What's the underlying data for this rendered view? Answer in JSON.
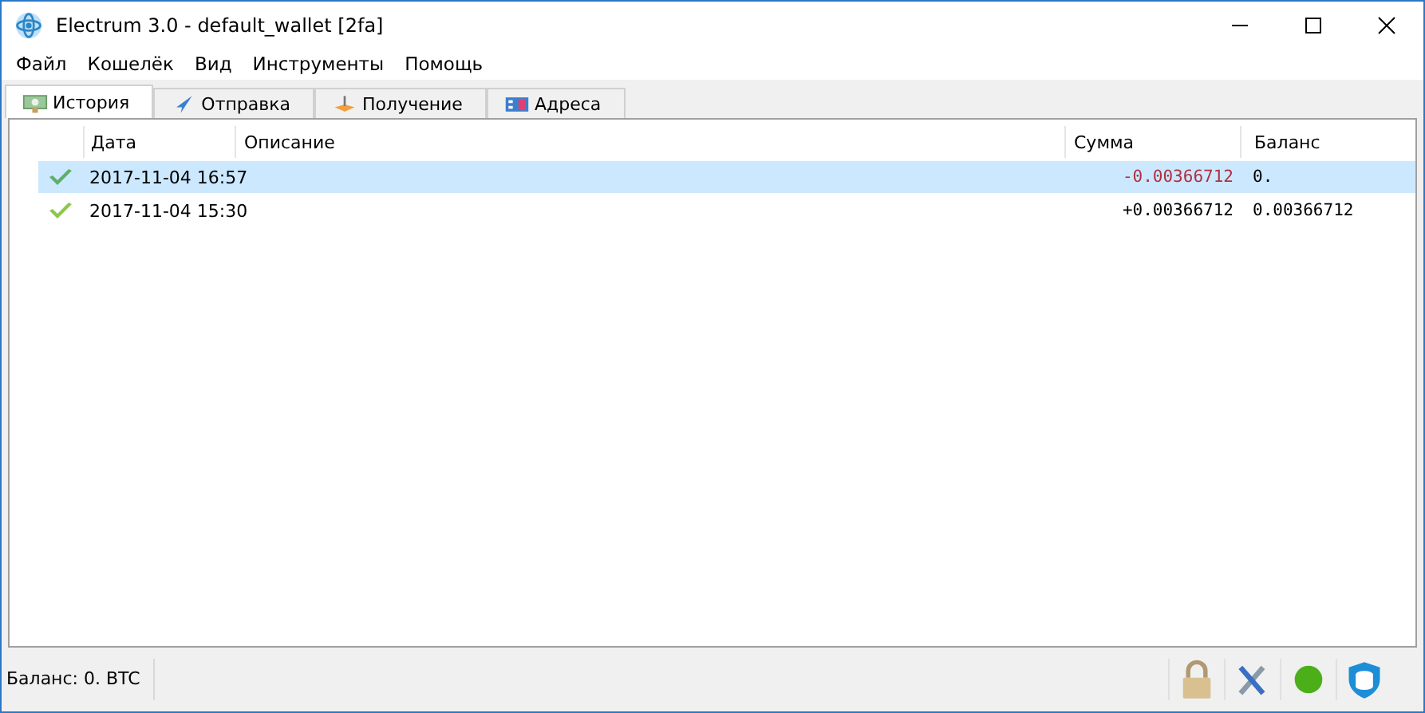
{
  "window": {
    "title": "Electrum 3.0  -  default_wallet  [2fa]"
  },
  "menu": [
    "Файл",
    "Кошелёк",
    "Вид",
    "Инструменты",
    "Помощь"
  ],
  "tabs": [
    {
      "label": "История",
      "selected": true,
      "kind": "history"
    },
    {
      "label": "Отправка",
      "selected": false,
      "kind": "send"
    },
    {
      "label": "Получение",
      "selected": false,
      "kind": "receive"
    },
    {
      "label": "Адреса",
      "selected": false,
      "kind": "addresses"
    }
  ],
  "table": {
    "columns": [
      "Дата",
      "Описание",
      "Сумма",
      "Баланс"
    ],
    "rows": [
      {
        "date": "2017-11-04 16:57",
        "amount": "-0.00366712",
        "negative": true,
        "balance": "0.",
        "selected": true
      },
      {
        "date": "2017-11-04 15:30",
        "amount": "+0.00366712",
        "negative": false,
        "balance": "0.00366712",
        "selected": false
      }
    ]
  },
  "status_bar": {
    "balance": "Баланс: 0. BTC",
    "online": true
  }
}
